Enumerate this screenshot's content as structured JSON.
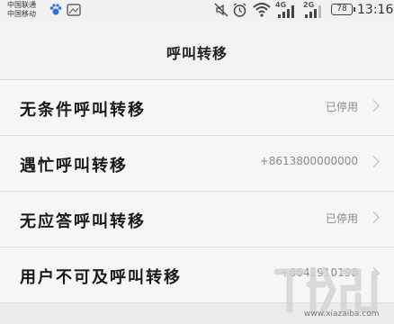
{
  "status_bar": {
    "carrier_1": "中国联通",
    "carrier_2": "中国移动",
    "network_4g": "4G",
    "network_2g": "2G",
    "battery": "78",
    "time": "13:16"
  },
  "header": {
    "title": "呼叫转移"
  },
  "rows": [
    {
      "label": "无条件呼叫转移",
      "value": "已停用"
    },
    {
      "label": "遇忙呼叫转移",
      "value": "+8613800000000"
    },
    {
      "label": "无应答呼叫转移",
      "value": "已停用"
    },
    {
      "label": "用户不可及呼叫转移",
      "value": "+8641910198"
    }
  ],
  "watermark": {
    "url": "www.xiazaiba.com"
  },
  "colors": {
    "background": "#ebebeb",
    "row_background": "#f6f6f6",
    "value_text": "#8a8a8a"
  }
}
